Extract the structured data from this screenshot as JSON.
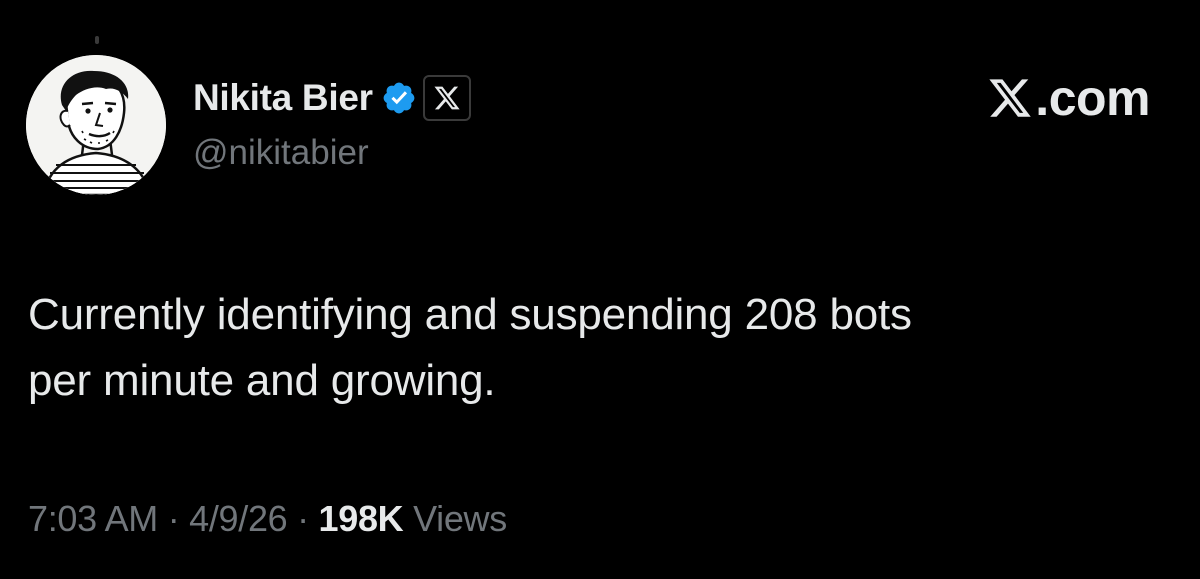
{
  "author": {
    "display_name": "Nikita Bier",
    "handle": "@nikitabier",
    "verified_icon": "verified-badge-icon",
    "affiliate_icon": "x-logo-icon"
  },
  "brand": {
    "icon": "x-logo-icon",
    "text": ".com"
  },
  "tweet": {
    "text": "Currently identifying and suspending 208 bots\nper minute and growing."
  },
  "meta": {
    "time": "7:03 AM",
    "separator": "·",
    "date": "4/9/26",
    "views_count": "198K",
    "views_label": "Views"
  },
  "colors": {
    "background": "#000000",
    "text_primary": "#e7e9ea",
    "text_secondary": "#71767b",
    "verified_blue": "#1d9bf0"
  }
}
